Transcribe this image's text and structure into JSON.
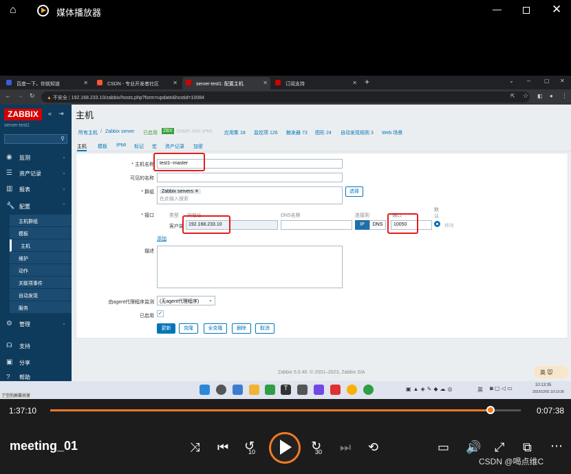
{
  "player": {
    "app_title": "媒体播放器",
    "current_time": "1:37:10",
    "remaining_time": "0:07:38",
    "progress": 0.935,
    "video_title": "meeting_01",
    "rewind_seconds": "10",
    "forward_seconds": "30",
    "watermark": "CSDN @喝点维C"
  },
  "browser": {
    "tabs": [
      {
        "label": "百度一下，你就知道",
        "color": "#3b5bdb"
      },
      {
        "label": "CSDN - 专业开发者社区",
        "color": "#fc5531"
      },
      {
        "label": "server-test1: 配置主机",
        "color": "#d40000"
      },
      {
        "label": "订阅支持",
        "color": "#d40000"
      }
    ],
    "security": "不安全",
    "url": "192.168.233.10/zabbix/hosts.php?form=update&hostid=10084"
  },
  "sidebar": {
    "logo": "ZABBIX",
    "server_name": "server-test1",
    "items": [
      {
        "label": "监测",
        "icon": "eye-icon"
      },
      {
        "label": "资产记录",
        "icon": "list-icon"
      },
      {
        "label": "报表",
        "icon": "chart-icon"
      },
      {
        "label": "配置",
        "icon": "wrench-icon"
      }
    ],
    "config_subitems": [
      "主机群组",
      "模板",
      "主机",
      "维护",
      "动作",
      "关联项事件",
      "自动发现",
      "服务"
    ],
    "bottom_items": [
      {
        "label": "管理",
        "icon": "gear-icon"
      },
      {
        "label": "支持",
        "icon": "headset-icon"
      },
      {
        "label": "分享",
        "icon": "share-icon"
      },
      {
        "label": "帮助",
        "icon": "help-icon"
      }
    ]
  },
  "page": {
    "title": "主机",
    "breadcrumb": {
      "all_hosts": "所有主机",
      "separator": "/",
      "host": "Zabbix server",
      "enabled": "已启用",
      "zbx": "ZBX",
      "protocols": "SNMP JMX IPMI",
      "apps": "应用集 18",
      "items": "监控项 126",
      "triggers": "触发器 73",
      "graphs": "图形 24",
      "discovery": "自动发现规则 3",
      "web": "Web 场景"
    },
    "tabs": [
      "主机",
      "模板",
      "IPMI",
      "标记",
      "宏",
      "资产记录",
      "加密"
    ],
    "form": {
      "hostname_label": "* 主机名称",
      "hostname_value": "test1--master",
      "visible_label": "可见的名称",
      "groups_label": "* 群组",
      "group_tag": "Zabbix servers",
      "group_placeholder": "在此输入搜索",
      "select_button": "选择",
      "interfaces_label": "* 接口",
      "col_type": "类型",
      "col_ip": "IP地址",
      "col_dns": "DNS名称",
      "col_connect": "连接到",
      "col_port": "端口",
      "col_default": "默认",
      "agent_label": "客户端",
      "ip_value": "192.168.233.10",
      "port_value": "10050",
      "ip_button": "IP",
      "dns_button": "DNS",
      "remove_link": "移除",
      "add_link": "添加",
      "description_label": "描述",
      "proxy_label": "由agent代理程序监测",
      "proxy_value": "(无agent代理程序)",
      "enabled_label": "已启用",
      "buttons": [
        "更新",
        "克隆",
        "全克隆",
        "删除",
        "取消"
      ]
    },
    "footer": "Zabbix 5.0.40. © 2001–2023, Zabbix SIA",
    "ime": "英"
  },
  "taskbar": {
    "left_note": "了空的屏幕共享",
    "ime": "英",
    "time": "10:13:35",
    "date": "2023/12/01 10:13:26"
  }
}
